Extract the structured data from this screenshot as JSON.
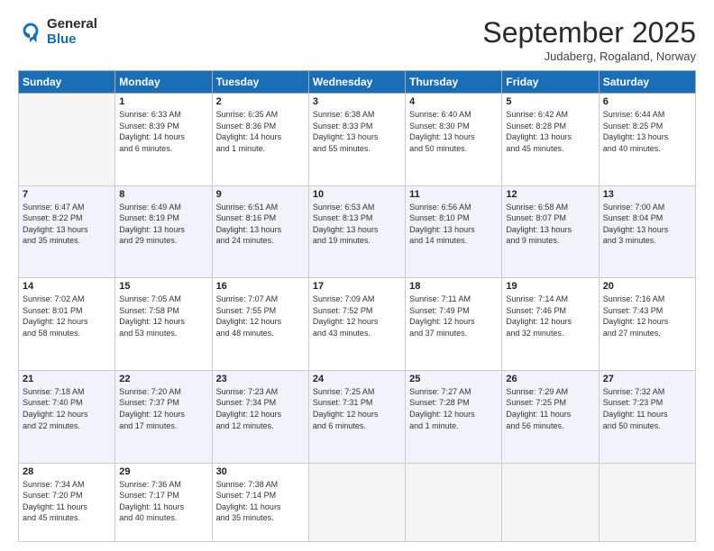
{
  "logo": {
    "line1": "General",
    "line2": "Blue"
  },
  "header": {
    "month": "September 2025",
    "location": "Judaberg, Rogaland, Norway"
  },
  "weekdays": [
    "Sunday",
    "Monday",
    "Tuesday",
    "Wednesday",
    "Thursday",
    "Friday",
    "Saturday"
  ],
  "weeks": [
    [
      {
        "day": "",
        "info": ""
      },
      {
        "day": "1",
        "info": "Sunrise: 6:33 AM\nSunset: 8:39 PM\nDaylight: 14 hours\nand 6 minutes."
      },
      {
        "day": "2",
        "info": "Sunrise: 6:35 AM\nSunset: 8:36 PM\nDaylight: 14 hours\nand 1 minute."
      },
      {
        "day": "3",
        "info": "Sunrise: 6:38 AM\nSunset: 8:33 PM\nDaylight: 13 hours\nand 55 minutes."
      },
      {
        "day": "4",
        "info": "Sunrise: 6:40 AM\nSunset: 8:30 PM\nDaylight: 13 hours\nand 50 minutes."
      },
      {
        "day": "5",
        "info": "Sunrise: 6:42 AM\nSunset: 8:28 PM\nDaylight: 13 hours\nand 45 minutes."
      },
      {
        "day": "6",
        "info": "Sunrise: 6:44 AM\nSunset: 8:25 PM\nDaylight: 13 hours\nand 40 minutes."
      }
    ],
    [
      {
        "day": "7",
        "info": "Sunrise: 6:47 AM\nSunset: 8:22 PM\nDaylight: 13 hours\nand 35 minutes."
      },
      {
        "day": "8",
        "info": "Sunrise: 6:49 AM\nSunset: 8:19 PM\nDaylight: 13 hours\nand 29 minutes."
      },
      {
        "day": "9",
        "info": "Sunrise: 6:51 AM\nSunset: 8:16 PM\nDaylight: 13 hours\nand 24 minutes."
      },
      {
        "day": "10",
        "info": "Sunrise: 6:53 AM\nSunset: 8:13 PM\nDaylight: 13 hours\nand 19 minutes."
      },
      {
        "day": "11",
        "info": "Sunrise: 6:56 AM\nSunset: 8:10 PM\nDaylight: 13 hours\nand 14 minutes."
      },
      {
        "day": "12",
        "info": "Sunrise: 6:58 AM\nSunset: 8:07 PM\nDaylight: 13 hours\nand 9 minutes."
      },
      {
        "day": "13",
        "info": "Sunrise: 7:00 AM\nSunset: 8:04 PM\nDaylight: 13 hours\nand 3 minutes."
      }
    ],
    [
      {
        "day": "14",
        "info": "Sunrise: 7:02 AM\nSunset: 8:01 PM\nDaylight: 12 hours\nand 58 minutes."
      },
      {
        "day": "15",
        "info": "Sunrise: 7:05 AM\nSunset: 7:58 PM\nDaylight: 12 hours\nand 53 minutes."
      },
      {
        "day": "16",
        "info": "Sunrise: 7:07 AM\nSunset: 7:55 PM\nDaylight: 12 hours\nand 48 minutes."
      },
      {
        "day": "17",
        "info": "Sunrise: 7:09 AM\nSunset: 7:52 PM\nDaylight: 12 hours\nand 43 minutes."
      },
      {
        "day": "18",
        "info": "Sunrise: 7:11 AM\nSunset: 7:49 PM\nDaylight: 12 hours\nand 37 minutes."
      },
      {
        "day": "19",
        "info": "Sunrise: 7:14 AM\nSunset: 7:46 PM\nDaylight: 12 hours\nand 32 minutes."
      },
      {
        "day": "20",
        "info": "Sunrise: 7:16 AM\nSunset: 7:43 PM\nDaylight: 12 hours\nand 27 minutes."
      }
    ],
    [
      {
        "day": "21",
        "info": "Sunrise: 7:18 AM\nSunset: 7:40 PM\nDaylight: 12 hours\nand 22 minutes."
      },
      {
        "day": "22",
        "info": "Sunrise: 7:20 AM\nSunset: 7:37 PM\nDaylight: 12 hours\nand 17 minutes."
      },
      {
        "day": "23",
        "info": "Sunrise: 7:23 AM\nSunset: 7:34 PM\nDaylight: 12 hours\nand 12 minutes."
      },
      {
        "day": "24",
        "info": "Sunrise: 7:25 AM\nSunset: 7:31 PM\nDaylight: 12 hours\nand 6 minutes."
      },
      {
        "day": "25",
        "info": "Sunrise: 7:27 AM\nSunset: 7:28 PM\nDaylight: 12 hours\nand 1 minute."
      },
      {
        "day": "26",
        "info": "Sunrise: 7:29 AM\nSunset: 7:25 PM\nDaylight: 11 hours\nand 56 minutes."
      },
      {
        "day": "27",
        "info": "Sunrise: 7:32 AM\nSunset: 7:23 PM\nDaylight: 11 hours\nand 50 minutes."
      }
    ],
    [
      {
        "day": "28",
        "info": "Sunrise: 7:34 AM\nSunset: 7:20 PM\nDaylight: 11 hours\nand 45 minutes."
      },
      {
        "day": "29",
        "info": "Sunrise: 7:36 AM\nSunset: 7:17 PM\nDaylight: 11 hours\nand 40 minutes."
      },
      {
        "day": "30",
        "info": "Sunrise: 7:38 AM\nSunset: 7:14 PM\nDaylight: 11 hours\nand 35 minutes."
      },
      {
        "day": "",
        "info": ""
      },
      {
        "day": "",
        "info": ""
      },
      {
        "day": "",
        "info": ""
      },
      {
        "day": "",
        "info": ""
      }
    ]
  ]
}
